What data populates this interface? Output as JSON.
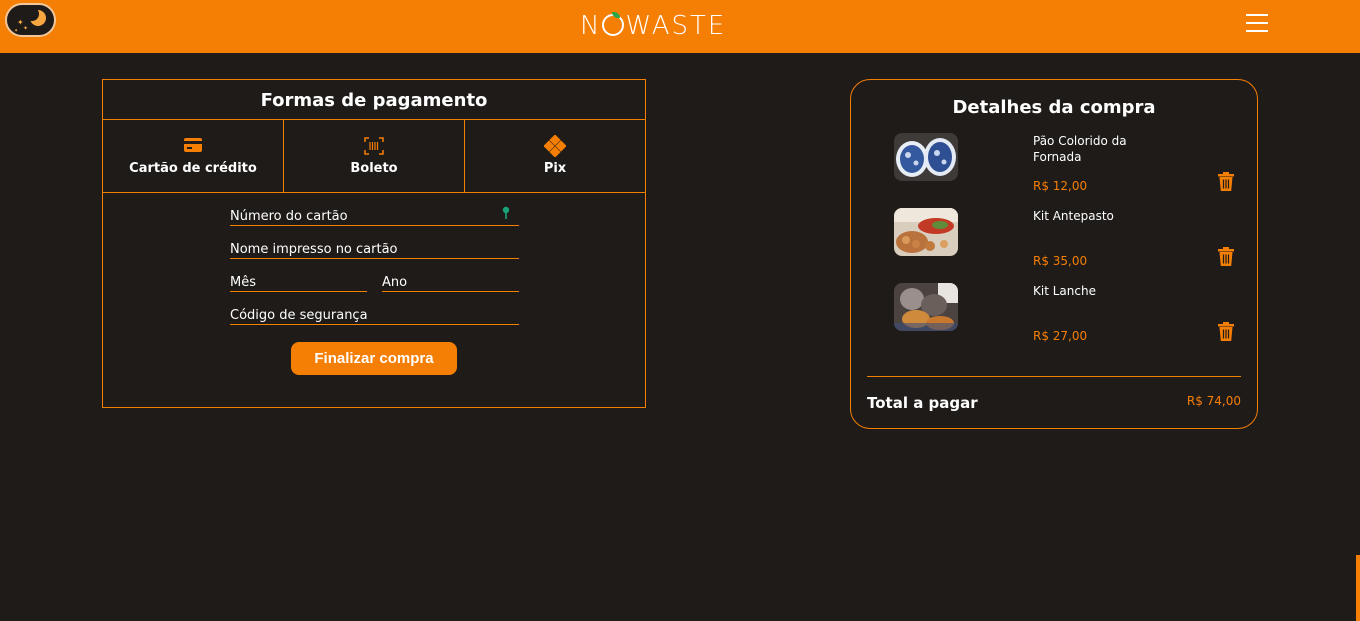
{
  "header": {
    "logo_text_left": "N",
    "logo_text_right": "WASTE",
    "theme_toggle_icon": "moon-stars-icon",
    "menu_icon": "hamburger-icon",
    "brand_color": "#f57e04"
  },
  "payment": {
    "title": "Formas de pagamento",
    "tabs": [
      {
        "label": "Cartão de crédito",
        "icon": "credit-card-icon"
      },
      {
        "label": "Boleto",
        "icon": "barcode-icon"
      },
      {
        "label": "Pix",
        "icon": "pix-icon"
      }
    ],
    "fields": {
      "card_number": "Número do cartão",
      "card_name": "Nome impresso no cartão",
      "month": "Mês",
      "year": "Ano",
      "security_code": "Código de segurança"
    },
    "finish_label": "Finalizar compra"
  },
  "cart": {
    "title": "Detalhes da compra",
    "items": [
      {
        "name": "Pão Colorido da Fornada",
        "price": "R$ 12,00"
      },
      {
        "name": "Kit Antepasto",
        "price": "R$ 35,00"
      },
      {
        "name": "Kit Lanche",
        "price": "R$ 27,00"
      }
    ],
    "total_label": "Total a pagar",
    "total_value": "R$ 74,00"
  }
}
